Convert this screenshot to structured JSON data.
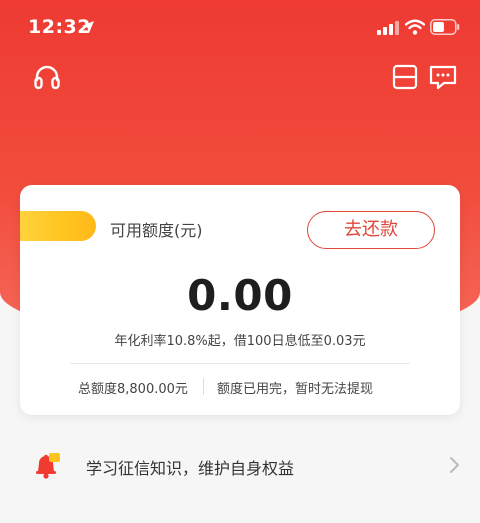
{
  "status_bar": {
    "time": "12:32"
  },
  "icons": {
    "location": "location-arrow-icon",
    "signal": "signal-icon",
    "wifi": "wifi-icon",
    "battery": "battery-icon",
    "headset": "headset-icon",
    "scan": "scan-icon",
    "message": "message-icon",
    "bell": "bell-icon",
    "chevron": "chevron-right-icon"
  },
  "colors": {
    "brand_red": "#ee3a33",
    "accent_yellow": "#ffc41f",
    "button_red": "#e0473b"
  },
  "credit_card": {
    "label": "可用额度(元)",
    "repay_button": "去还款",
    "available_amount": "0.00",
    "rate_note": "年化利率10.8%起，借100日息低至0.03元",
    "total_quota": "总额度8,800.00元",
    "quota_status": "额度已用完，暂时无法提现"
  },
  "list": {
    "items": [
      {
        "label": "学习征信知识，维护自身权益"
      }
    ]
  }
}
